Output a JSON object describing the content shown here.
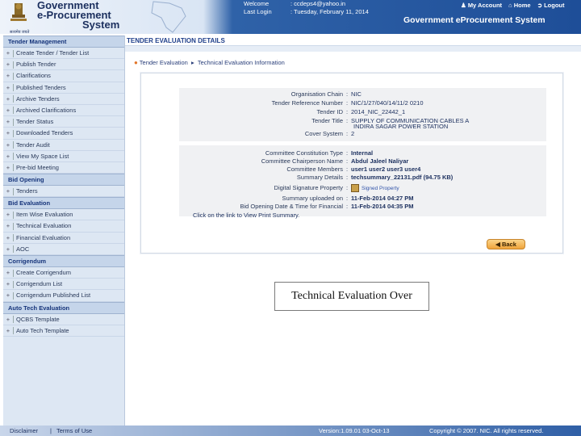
{
  "header": {
    "brand_lines": [
      "Government",
      "e-Procurement",
      "System"
    ],
    "emblem_text": "सत्यमेव जयते",
    "welcome_label": "Welcome",
    "welcome_value": ": ccdeps4@yahoo.in",
    "last_login_label": "Last Login",
    "last_login_value": ": Tuesday, February 11, 2014",
    "my_account": "My Account",
    "home": "Home",
    "logout": "Logout",
    "system_title": "Government eProcurement System"
  },
  "sidebar": {
    "sections": [
      {
        "title": "Tender Management",
        "items": [
          "Create Tender / Tender List",
          "Publish Tender",
          "Clarifications",
          "Published Tenders",
          "Archive Tenders",
          "Archived Clarifications",
          "Tender Status",
          "Downloaded Tenders",
          "Tender Audit",
          "View My Space List",
          "Pre-bid Meeting"
        ]
      },
      {
        "title": "Bid Opening",
        "items": [
          "Tenders"
        ]
      },
      {
        "title": "Bid Evaluation",
        "items": [
          "Item Wise Evaluation",
          "Technical Evaluation",
          "Financial Evaluation",
          "AOC"
        ]
      },
      {
        "title": "Corrigendum",
        "items": [
          "Create Corrigendum",
          "Corrigendum List",
          "Corrigendum Published List"
        ]
      },
      {
        "title": "Auto Tech Evaluation",
        "items": [
          "QCBS Template",
          "Auto Tech Template"
        ]
      }
    ]
  },
  "main": {
    "page_heading": "TENDER EVALUATION DETAILS",
    "breadcrumb": [
      "Tender Evaluation",
      "Technical Evaluation Information"
    ],
    "org_chain_label": "Organisation Chain",
    "org_chain_value": "NIC",
    "tender_ref_label": "Tender Reference Number",
    "tender_ref_value": "NIC/1/27/040/14/11/2 0210",
    "tender_id_label": "Tender ID",
    "tender_id_value": "2014_NIC_22442_1",
    "tender_title_label": "Tender Title",
    "tender_title_value_1": "SUPPLY OF COMMUNICATION CABLES A",
    "tender_title_value_2": "INDIRA SAGAR POWER STATION",
    "cover_system_label": "Cover System",
    "cover_system_value": "2",
    "committee_type_label": "Committee Constitution Type",
    "committee_type_value": "Internal",
    "chairperson_label": "Committee Chairperson Name",
    "chairperson_value": "Abdul Jaleel Naliyar",
    "members_label": "Committee Members",
    "members_value": "user1 user2 user3 user4",
    "summary_label": "Summary Details",
    "summary_value": "techsummary_22131.pdf (94.75 KB)",
    "signature_label": "Digital Signature Property",
    "signature_value": "Signed Property",
    "uploaded_label": "Summary uploaded on",
    "uploaded_value": "11-Feb-2014 04:27 PM",
    "bid_opening_label": "Bid Opening Date & Time for Financial",
    "bid_opening_value": "11-Feb-2014 04:35 PM",
    "print_link": "Click on the link to View Print Summary.",
    "back_button": "Back",
    "overlay_caption": "Technical Evaluation Over"
  },
  "footer": {
    "disclaimer": "Disclaimer",
    "separator": "|",
    "terms": "Terms of Use",
    "version": "Version:1.09.01 03-Oct-13",
    "copyright": "Copyright © 2007. NIC. All rights reserved."
  }
}
